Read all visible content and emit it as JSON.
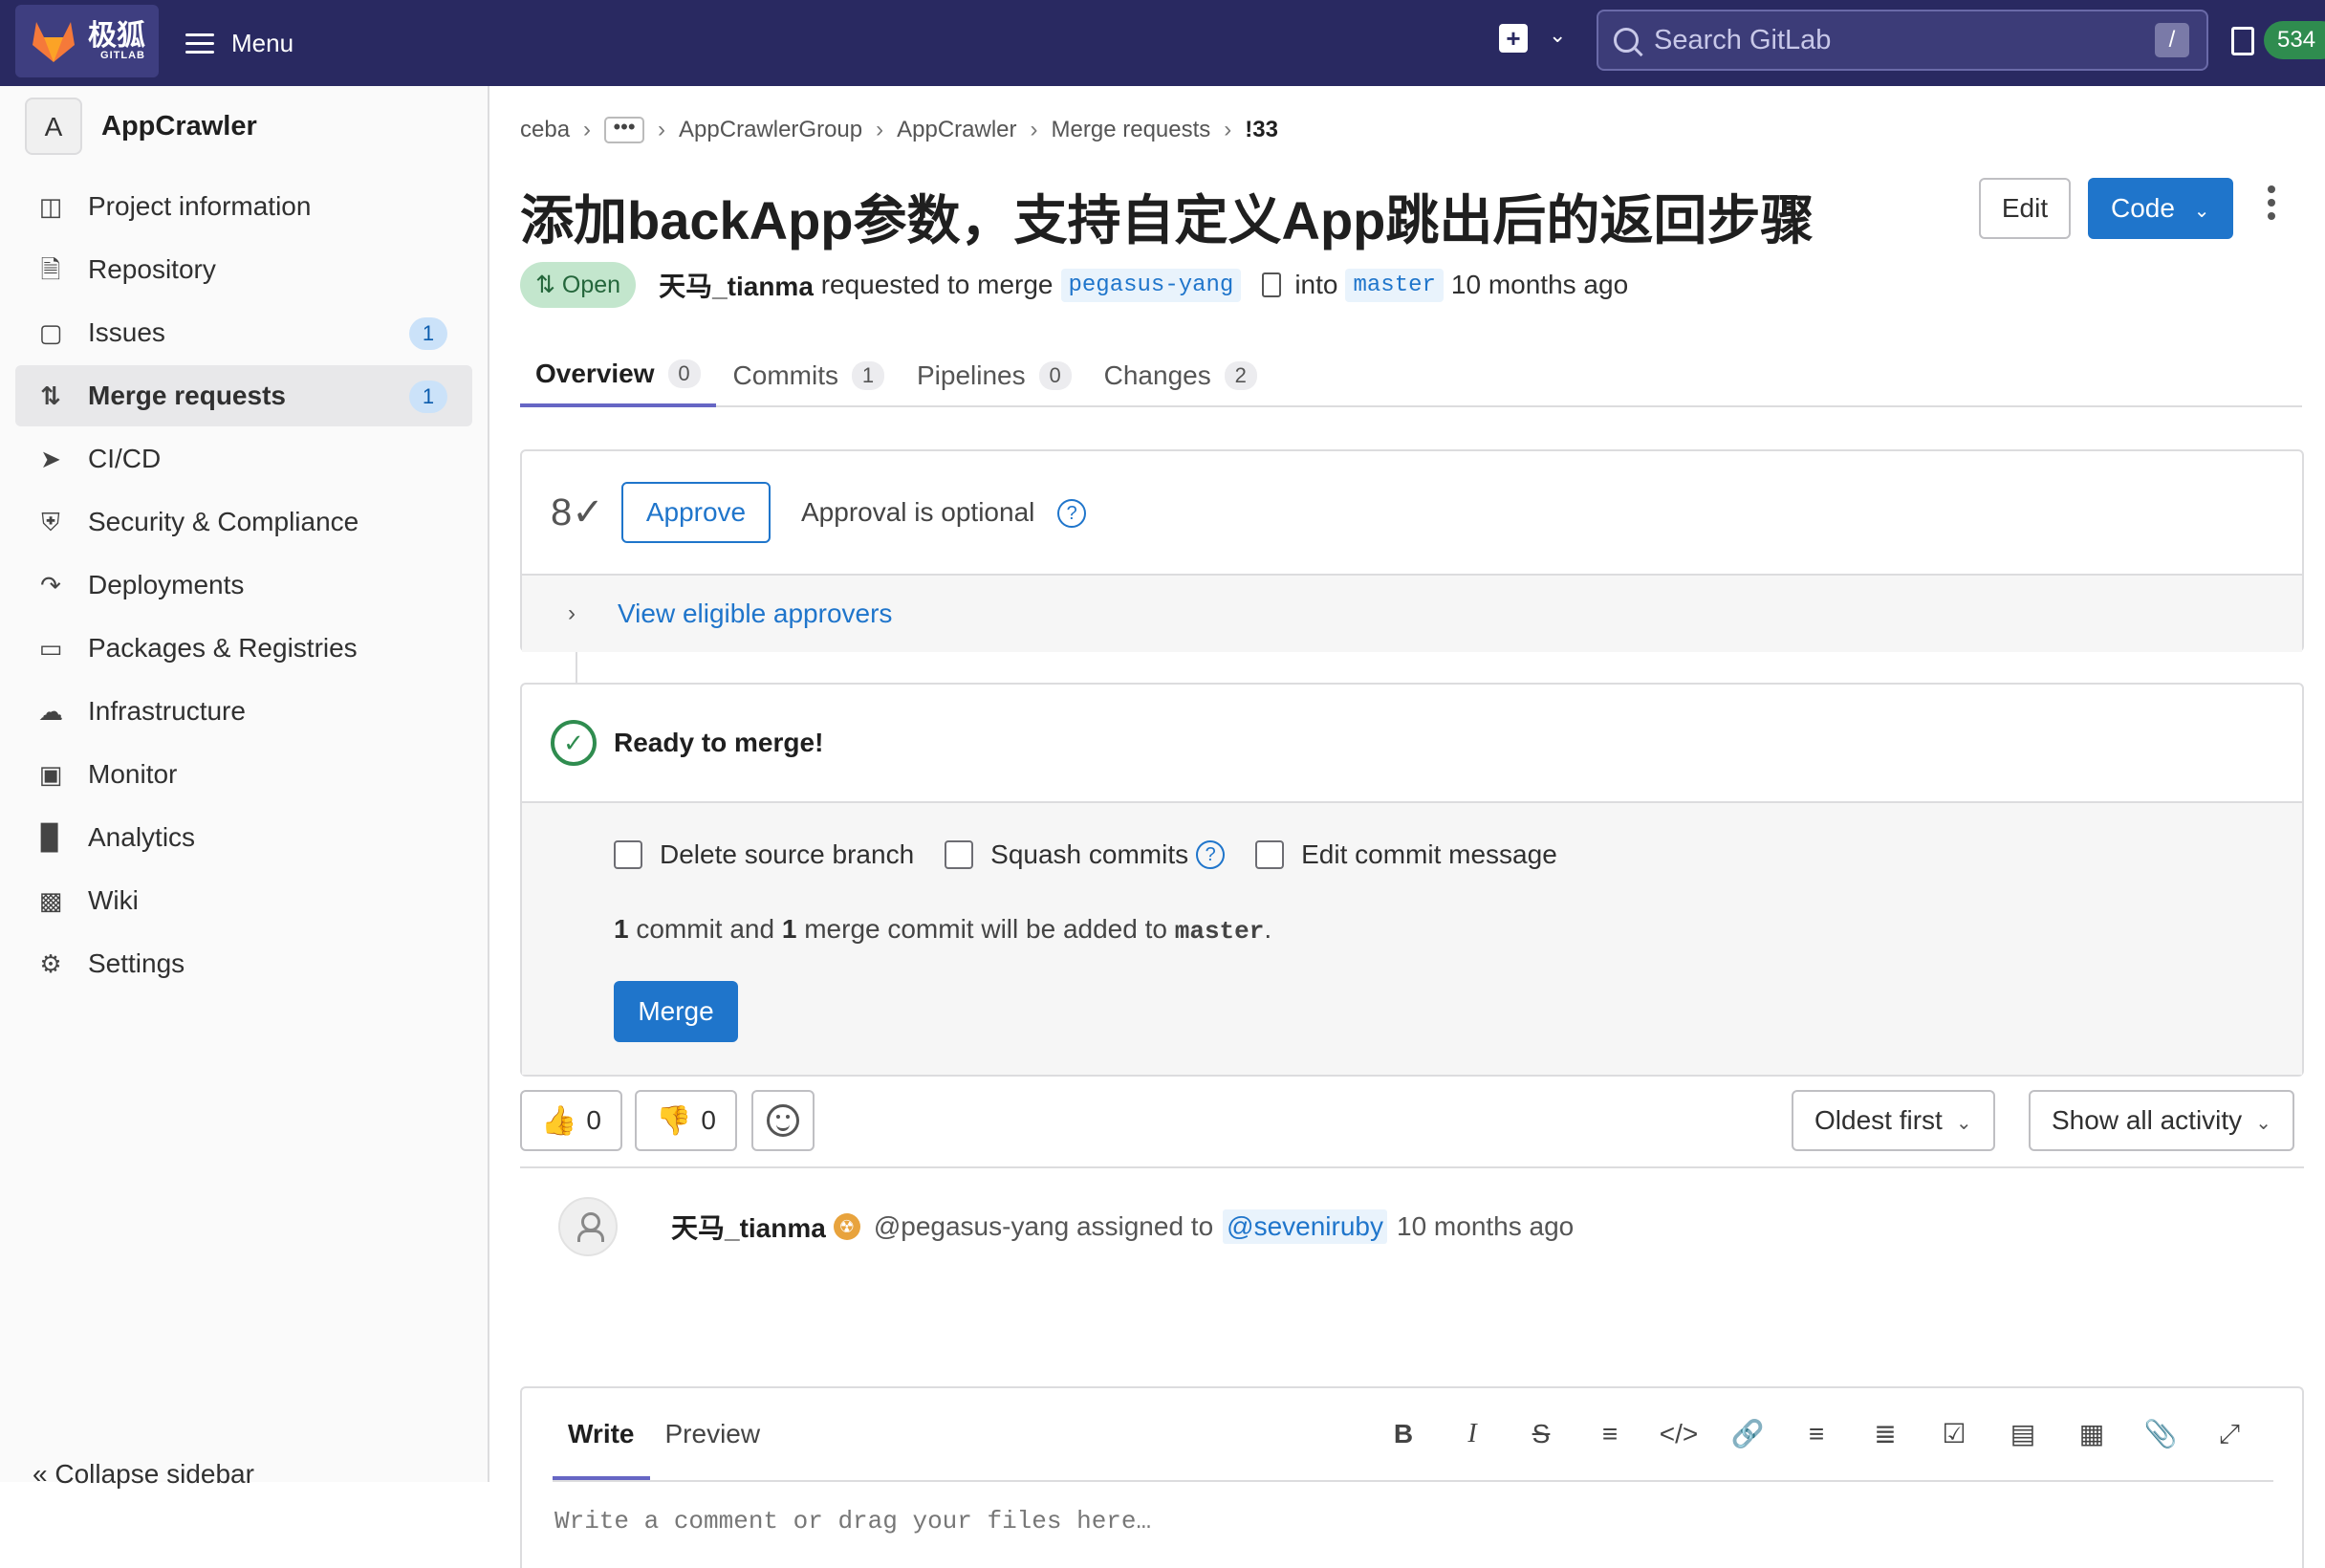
{
  "topbar": {
    "brand": "极狐",
    "brand_sub": "GITLAB",
    "menu_label": "Menu",
    "search_placeholder": "Search GitLab",
    "search_shortcut": "/",
    "todo_count": "534"
  },
  "sidebar": {
    "project_initial": "A",
    "project_name": "AppCrawler",
    "items": [
      {
        "label": "Project information",
        "icon": "info-doc-icon"
      },
      {
        "label": "Repository",
        "icon": "document-icon"
      },
      {
        "label": "Issues",
        "icon": "issues-icon",
        "count": "1"
      },
      {
        "label": "Merge requests",
        "icon": "merge-request-icon",
        "count": "1"
      },
      {
        "label": "CI/CD",
        "icon": "rocket-icon"
      },
      {
        "label": "Security & Compliance",
        "icon": "shield-icon"
      },
      {
        "label": "Deployments",
        "icon": "deployments-icon"
      },
      {
        "label": "Packages & Registries",
        "icon": "package-icon"
      },
      {
        "label": "Infrastructure",
        "icon": "cloud-gear-icon"
      },
      {
        "label": "Monitor",
        "icon": "monitor-icon"
      },
      {
        "label": "Analytics",
        "icon": "chart-icon"
      },
      {
        "label": "Wiki",
        "icon": "book-icon"
      },
      {
        "label": "Settings",
        "icon": "gear-icon"
      }
    ],
    "collapse_label": "Collapse sidebar"
  },
  "breadcrumb": {
    "items": [
      "ceba",
      "•••",
      "AppCrawlerGroup",
      "AppCrawler",
      "Merge requests",
      "!33"
    ]
  },
  "mr": {
    "title": "添加backApp参数，支持自定义App跳出后的返回步骤",
    "edit_label": "Edit",
    "code_label": "Code",
    "status": "Open",
    "author": "天马_tianma",
    "requested_text": "requested to merge",
    "source_branch": "pegasus-yang",
    "into_text": "into",
    "target_branch": "master",
    "time": "10 months ago"
  },
  "tabs": [
    {
      "label": "Overview",
      "count": "0"
    },
    {
      "label": "Commits",
      "count": "1"
    },
    {
      "label": "Pipelines",
      "count": "0"
    },
    {
      "label": "Changes",
      "count": "2"
    }
  ],
  "approval": {
    "approve_label": "Approve",
    "optional_text": "Approval is optional",
    "view_approvers": "View eligible approvers"
  },
  "merge": {
    "ready_text": "Ready to merge!",
    "options": [
      "Delete source branch",
      "Squash commits",
      "Edit commit message"
    ],
    "commits_n1": "1",
    "commits_t1": "commit and",
    "commits_n2": "1",
    "commits_t2": "merge commit will be added to",
    "commits_branch": "master",
    "commits_end": ".",
    "merge_label": "Merge"
  },
  "reactions": {
    "thumbs_up": "0",
    "thumbs_down": "0"
  },
  "activity": {
    "sort_label": "Oldest first",
    "filter_label": "Show all activity"
  },
  "note": {
    "author": "天马_tianma",
    "handle": "@pegasus-yang",
    "action": "assigned to",
    "assignee": "@seveniruby",
    "time": "10 months ago"
  },
  "editor": {
    "write_tab": "Write",
    "preview_tab": "Preview",
    "placeholder": "Write a comment or drag your files here…"
  }
}
